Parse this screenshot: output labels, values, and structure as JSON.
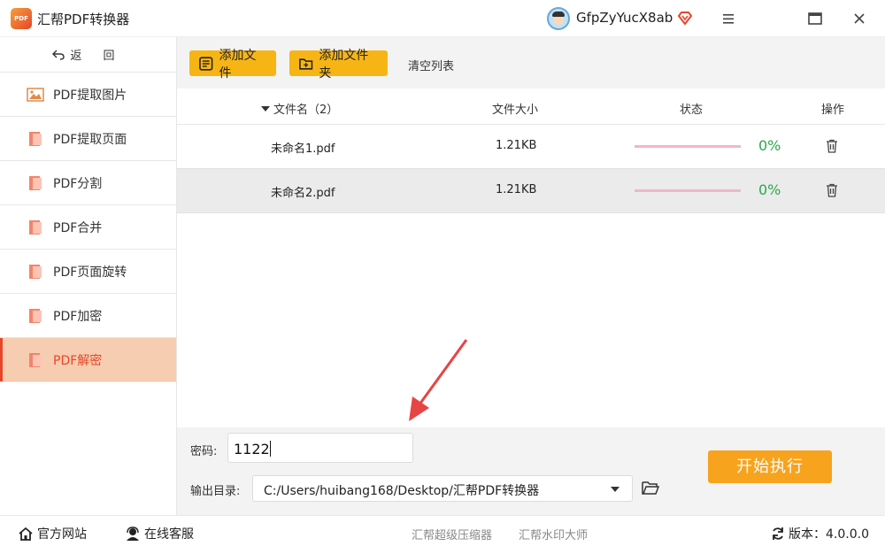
{
  "app": {
    "title": "汇帮PDF转换器",
    "logo_text": "PDF"
  },
  "user": {
    "name": "GfpZyYucX8ab"
  },
  "sidebar": {
    "back_label": "返 回",
    "items": [
      {
        "label": "PDF提取图片",
        "active": false
      },
      {
        "label": "PDF提取页面",
        "active": false
      },
      {
        "label": "PDF分割",
        "active": false
      },
      {
        "label": "PDF合并",
        "active": false
      },
      {
        "label": "PDF页面旋转",
        "active": false
      },
      {
        "label": "PDF加密",
        "active": false
      },
      {
        "label": "PDF解密",
        "active": true
      }
    ]
  },
  "toolbar": {
    "add_file": "添加文件",
    "add_folder": "添加文件夹",
    "clear_list": "清空列表"
  },
  "table": {
    "headers": {
      "name": "文件名（2）",
      "size": "文件大小",
      "status": "状态",
      "action": "操作"
    },
    "rows": [
      {
        "name": "未命名1.pdf",
        "size": "1.21KB",
        "percent": "0%",
        "progress": 0
      },
      {
        "name": "未命名2.pdf",
        "size": "1.21KB",
        "percent": "0%",
        "progress": 0
      }
    ]
  },
  "form": {
    "password_label": "密码:",
    "password_value": "1122",
    "output_label": "输出目录:",
    "output_path": "C:/Users/huibang168/Desktop/汇帮PDF转换器",
    "start_button": "开始执行"
  },
  "footer": {
    "site": "官方网站",
    "service": "在线客服",
    "compress": "汇帮超级压缩器",
    "watermark": "汇帮水印大师",
    "version": "版本：4.0.0.0"
  },
  "colors": {
    "accent": "#f7b515",
    "start": "#f7a31d",
    "active_bg": "#f6cdb0",
    "active_text": "#e8452a",
    "percent": "#2aa84a",
    "annotation": "#e84444"
  }
}
